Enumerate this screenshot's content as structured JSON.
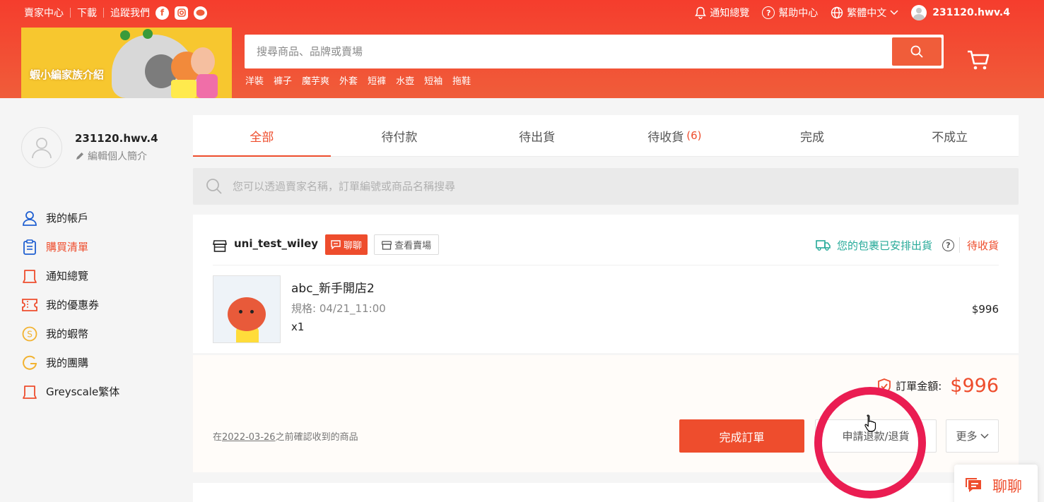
{
  "topbar": {
    "seller_center": "賣家中心",
    "download": "下載",
    "follow_us": "追蹤我們",
    "notifications": "通知總覽",
    "help": "幫助中心",
    "language": "繁體中文",
    "username": "231120.hwv.4"
  },
  "banner": {
    "text": "蝦小編家族介紹"
  },
  "search": {
    "placeholder": "搜尋商品、品牌或賣場",
    "hints": [
      "洋裝",
      "褲子",
      "魔芋爽",
      "外套",
      "短褲",
      "水壺",
      "短袖",
      "拖鞋"
    ]
  },
  "profile": {
    "username": "231120.hwv.4",
    "edit_label": "編輯個人簡介"
  },
  "sidebar": {
    "items": [
      {
        "label": "我的帳戶",
        "icon": "user-icon",
        "color": "#1f5fd1"
      },
      {
        "label": "購買清單",
        "icon": "clipboard-icon",
        "color": "#1f5fd1",
        "active": true
      },
      {
        "label": "通知總覽",
        "icon": "bell-icon",
        "color": "#ee4d2d"
      },
      {
        "label": "我的優惠券",
        "icon": "coupon-icon",
        "color": "#ee4d2d"
      },
      {
        "label": "我的蝦幣",
        "icon": "coin-icon",
        "color": "#f2b230"
      },
      {
        "label": "我的團購",
        "icon": "group-buy-icon",
        "color": "#f2b230"
      },
      {
        "label": "Greyscale繁体",
        "icon": "bell-icon",
        "color": "#ee4d2d"
      }
    ]
  },
  "tabs": {
    "all": "全部",
    "to_pay": "待付款",
    "to_ship": "待出貨",
    "to_receive": "待收貨",
    "to_receive_count": "(6)",
    "completed": "完成",
    "cancelled": "不成立"
  },
  "order_search": {
    "placeholder": "您可以透過賣家名稱，訂單編號或商品名稱搜尋"
  },
  "order": {
    "shop_name": "uni_test_wiley",
    "chat_label": "聊聊",
    "view_shop_label": "查看賣場",
    "shipping_status": "您的包裹已安排出貨",
    "status": "待收貨",
    "product": {
      "name": "abc_新手開店2",
      "variation": "規格: 04/21_11:00",
      "quantity": "x1",
      "price": "$996"
    },
    "total_label": "訂單金額:",
    "total_amount": "$996",
    "confirm_prefix": "在",
    "confirm_date": "2022-03-26",
    "confirm_suffix": "之前確認收到的商品",
    "complete_button": "完成訂單",
    "refund_button": "申請退款/退貨",
    "more_button": "更多"
  },
  "floating_chat": {
    "label": "聊聊"
  },
  "colors": {
    "brand": "#ee4d2d",
    "ship_green": "#26aa99",
    "highlight": "#ea1d52"
  }
}
